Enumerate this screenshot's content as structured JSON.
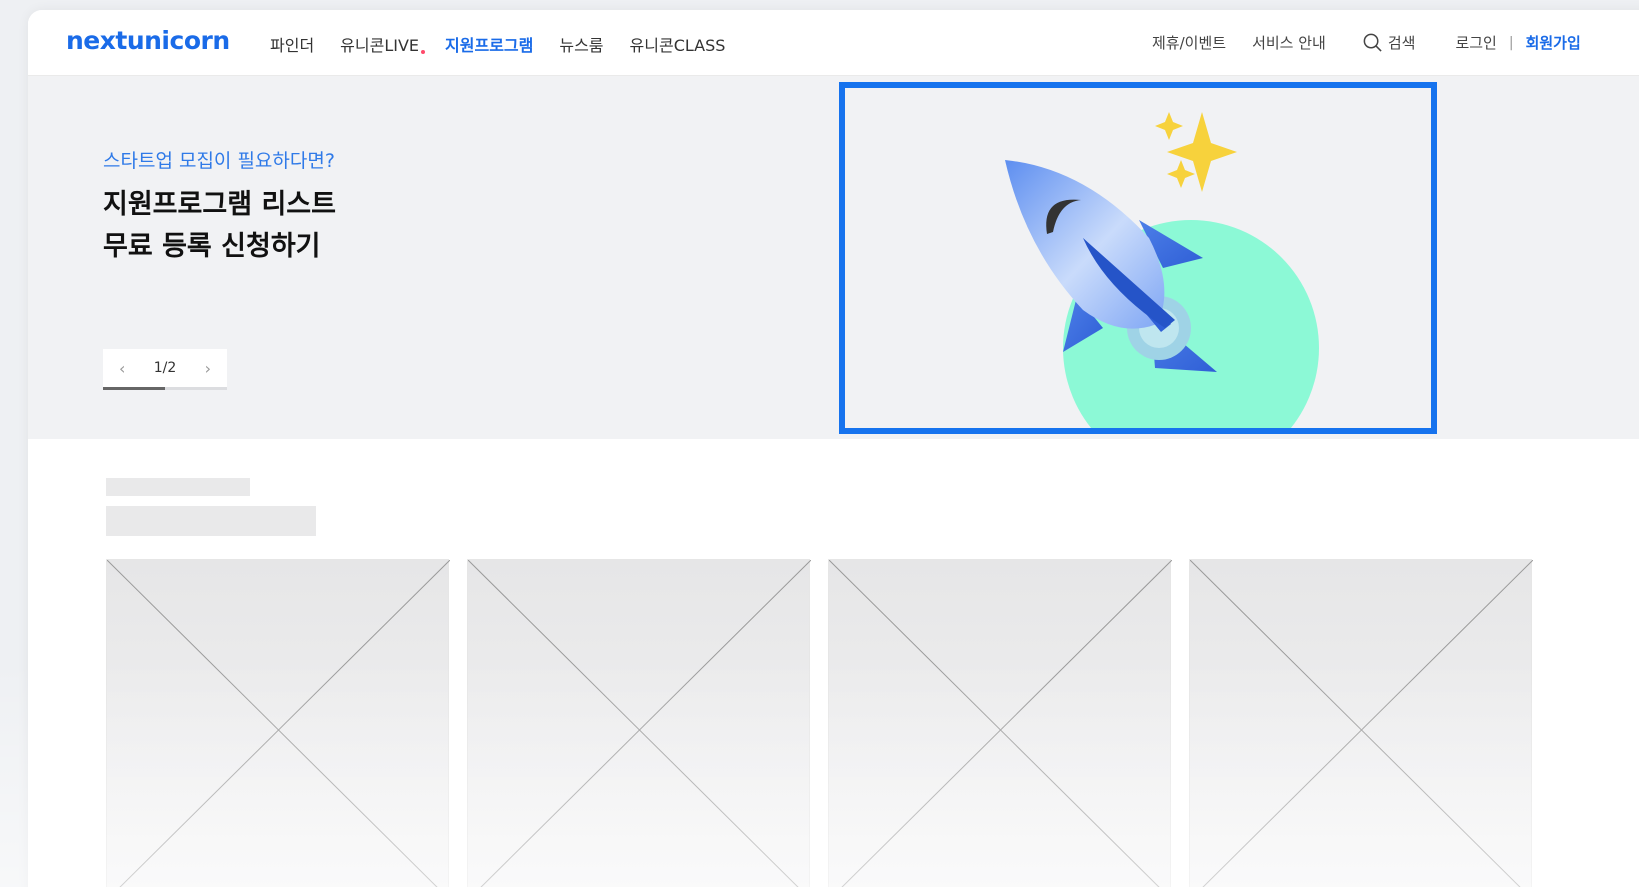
{
  "header": {
    "logo": "nextunicorn",
    "nav": [
      {
        "label": "파인더"
      },
      {
        "label": "유니콘LIVE"
      },
      {
        "label": "지원프로그램"
      },
      {
        "label": "뉴스룸"
      },
      {
        "label": "유니콘CLASS"
      }
    ],
    "util": {
      "partner": "제휴/이벤트",
      "service": "서비스 안내",
      "search": "검색",
      "login": "로그인",
      "separator": "|",
      "signup": "회원가입"
    }
  },
  "hero": {
    "subtitle": "스타트업 모집이 필요하다면?",
    "title": "지원프로그램 리스트\n무료 등록 신청하기",
    "pager": {
      "prev": "‹",
      "text": "1/2",
      "next": "›",
      "progress": 0.5
    }
  },
  "colors": {
    "brand": "#1a6be8",
    "highlight_border": "#1673ee",
    "nav_dot": "#ff4a6b",
    "hero_bg": "#f1f2f4"
  },
  "cards": [
    {
      "icon": "image-placeholder-icon"
    },
    {
      "icon": "image-placeholder-icon"
    },
    {
      "icon": "image-placeholder-icon"
    },
    {
      "icon": "image-placeholder-icon"
    }
  ]
}
